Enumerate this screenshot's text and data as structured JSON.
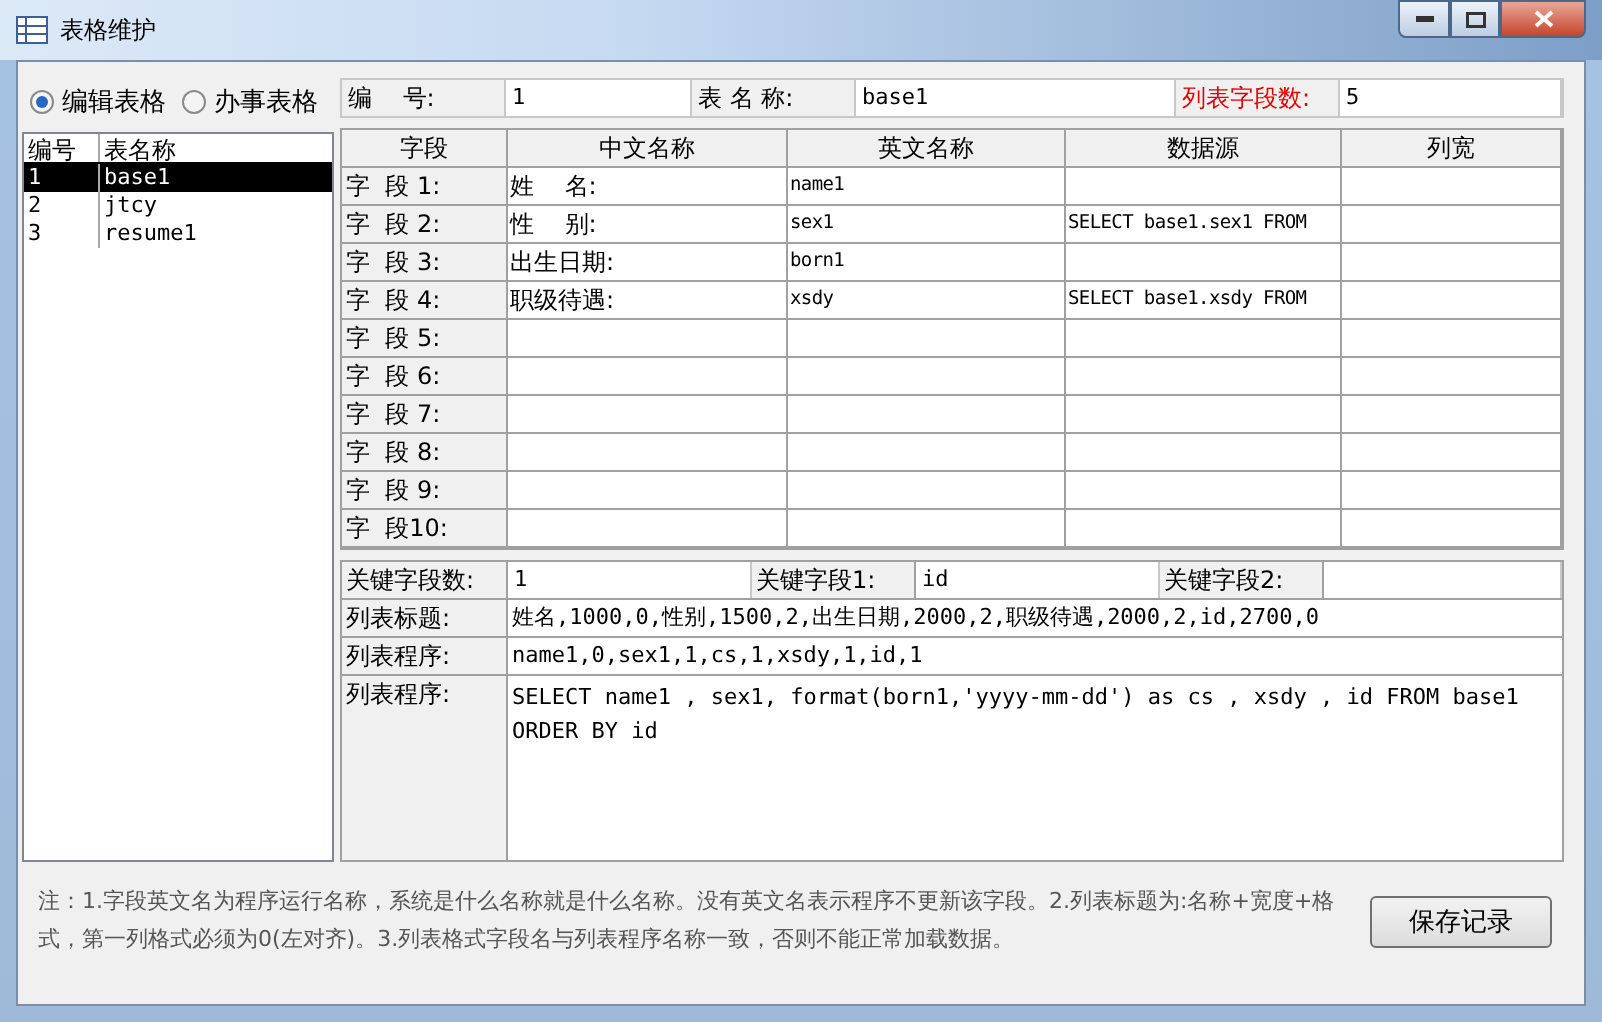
{
  "window": {
    "title": "表格维护"
  },
  "mode_radios": [
    {
      "label": "编辑表格",
      "selected": true
    },
    {
      "label": "办事表格",
      "selected": false
    }
  ],
  "table_list": {
    "columns": [
      "编号",
      "表名称"
    ],
    "rows": [
      {
        "cells": [
          "1",
          "base1"
        ],
        "selected": true
      },
      {
        "cells": [
          "2",
          "jtcy"
        ],
        "selected": false
      },
      {
        "cells": [
          "3",
          "resume1"
        ],
        "selected": false
      }
    ]
  },
  "header_fields": [
    {
      "label": "编    号:",
      "value": "1",
      "kind": "normal"
    },
    {
      "label": "表 名 称:",
      "value": "base1",
      "kind": "normal"
    },
    {
      "label": "列表字段数:",
      "value": "5",
      "kind": "highlight"
    }
  ],
  "fields_grid": {
    "columns": [
      "字段",
      "中文名称",
      "英文名称",
      "数据源",
      "列宽"
    ],
    "rows": [
      {
        "label": "字  段 1:",
        "cells": [
          "姓    名:",
          "name1",
          "",
          ""
        ]
      },
      {
        "label": "字  段 2:",
        "cells": [
          "性    别:",
          "sex1",
          "SELECT base1.sex1 FROM",
          ""
        ]
      },
      {
        "label": "字  段 3:",
        "cells": [
          "出生日期:",
          "born1",
          "",
          ""
        ]
      },
      {
        "label": "字  段 4:",
        "cells": [
          "职级待遇:",
          "xsdy",
          "SELECT base1.xsdy FROM",
          ""
        ]
      },
      {
        "label": "字  段 5:",
        "cells": [
          "",
          "",
          "",
          ""
        ]
      },
      {
        "label": "字  段 6:",
        "cells": [
          "",
          "",
          "",
          ""
        ]
      },
      {
        "label": "字  段 7:",
        "cells": [
          "",
          "",
          "",
          ""
        ]
      },
      {
        "label": "字  段 8:",
        "cells": [
          "",
          "",
          "",
          ""
        ]
      },
      {
        "label": "字  段 9:",
        "cells": [
          "",
          "",
          "",
          ""
        ]
      },
      {
        "label": "字  段10:",
        "cells": [
          "",
          "",
          "",
          ""
        ]
      }
    ]
  },
  "key_fields": [
    {
      "label": "关键字段数:",
      "value": "1"
    },
    {
      "label": "关键字段1:",
      "value": "id"
    },
    {
      "label": "关键字段2:"
    }
  ],
  "list_settings": [
    {
      "label": "列表标题:",
      "value": "姓名,1000,0,性别,1500,2,出生日期,2000,2,职级待遇,2000,2,id,2700,0",
      "kind": "line"
    },
    {
      "label": "列表程序:",
      "value": "name1,0,sex1,1,cs,1,xsdy,1,id,1",
      "kind": "line"
    },
    {
      "label": "列表程序:",
      "value": "SELECT name1 , sex1, format(born1,'yyyy-mm-dd') as cs , xsdy , id FROM base1    ORDER BY id",
      "kind": "area"
    }
  ],
  "note": "注：1.字段英文名为程序运行名称，系统是什么名称就是什么名称。没有英文名表示程序不更新该字段。2.列表标题为:名称+宽度+格式，第一列格式必须为0(左对齐)。3.列表格式字段名与列表程序名称一致，否则不能正常加载数据。",
  "save_button": "保存记录"
}
